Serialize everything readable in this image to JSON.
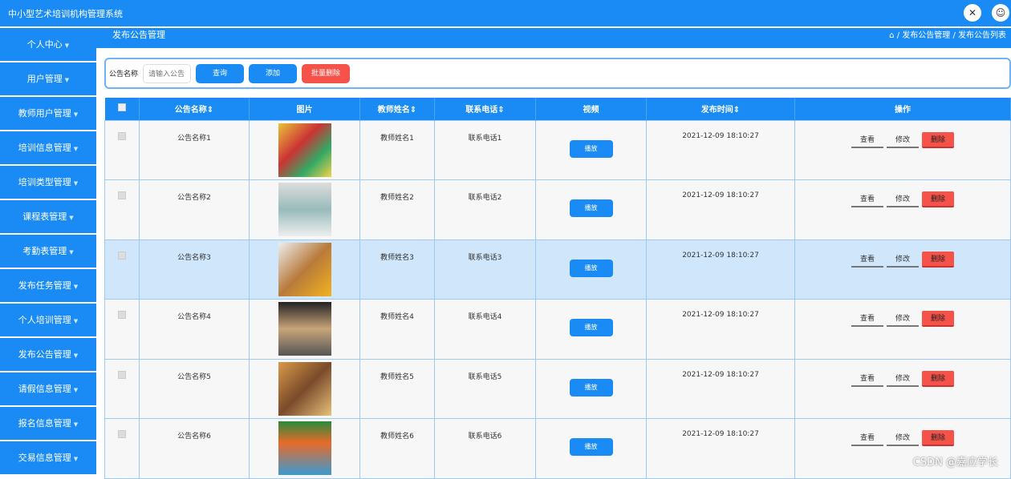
{
  "app_title": "中小型艺术培训机构管理系统",
  "header_icons": [
    "fullscreen-icon",
    "user-icon"
  ],
  "sidebar": {
    "items": [
      "个人中心",
      "用户管理",
      "教师用户管理",
      "培训信息管理",
      "培训类型管理",
      "课程表管理",
      "考勤表管理",
      "发布任务管理",
      "个人培训管理",
      "发布公告管理",
      "请假信息管理",
      "报名信息管理",
      "交易信息管理"
    ]
  },
  "page_title": "发布公告管理",
  "breadcrumb": {
    "home": "⌂",
    "sep": "/",
    "items": [
      "发布公告管理",
      "发布公告列表"
    ]
  },
  "search": {
    "label": "公告名称",
    "placeholder": "请输入公告",
    "query": "查询",
    "add": "添加",
    "batch_delete": "批量删除"
  },
  "table": {
    "headers": [
      "公告名称⇕",
      "图片",
      "教师姓名⇕",
      "联系电话⇕",
      "视频",
      "发布时间⇕",
      "操作"
    ],
    "play": "播放",
    "view": "查看",
    "edit": "修改",
    "delete": "删除",
    "rows": [
      {
        "name": "公告名称1",
        "teacher": "教师姓名1",
        "phone": "联系电话1",
        "time": "2021-12-09 18:10:27"
      },
      {
        "name": "公告名称2",
        "teacher": "教师姓名2",
        "phone": "联系电话2",
        "time": "2021-12-09 18:10:27"
      },
      {
        "name": "公告名称3",
        "teacher": "教师姓名3",
        "phone": "联系电话3",
        "time": "2021-12-09 18:10:27"
      },
      {
        "name": "公告名称4",
        "teacher": "教师姓名4",
        "phone": "联系电话4",
        "time": "2021-12-09 18:10:27"
      },
      {
        "name": "公告名称5",
        "teacher": "教师姓名5",
        "phone": "联系电话5",
        "time": "2021-12-09 18:10:27"
      },
      {
        "name": "公告名称6",
        "teacher": "教师姓名6",
        "phone": "联系电话6",
        "time": "2021-12-09 18:10:27"
      }
    ]
  },
  "watermark": "CSDN @嘉应学长"
}
